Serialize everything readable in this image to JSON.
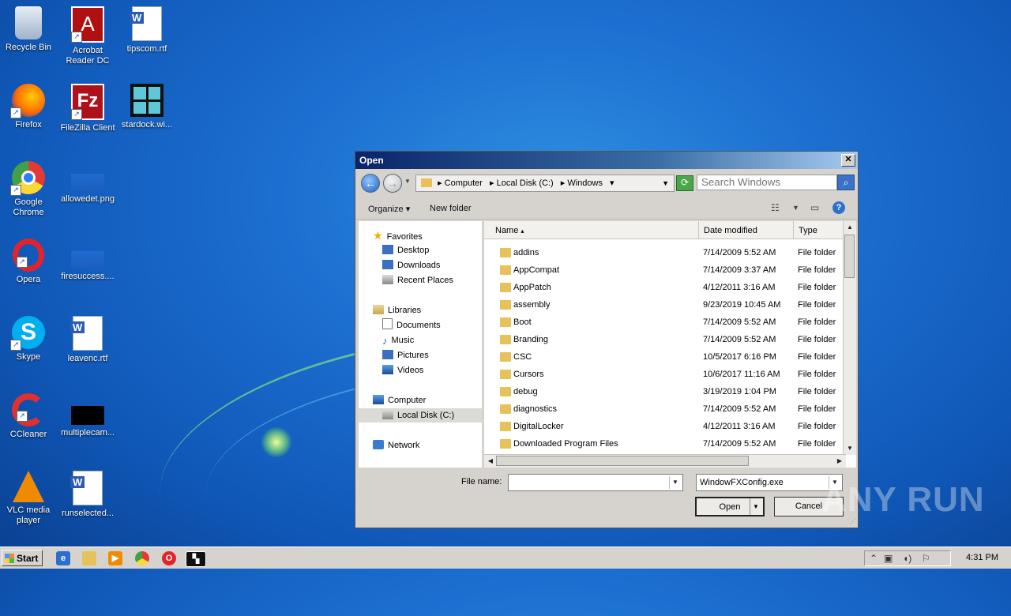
{
  "desktop": {
    "icons": [
      {
        "label": "Recycle Bin"
      },
      {
        "label": "Acrobat Reader DC"
      },
      {
        "label": "tipscom.rtf"
      },
      {
        "label": "Firefox"
      },
      {
        "label": "FileZilla Client"
      },
      {
        "label": "stardock.wi..."
      },
      {
        "label": "Google Chrome"
      },
      {
        "label": "allowedet.png"
      },
      {
        "label": "Opera"
      },
      {
        "label": "firesuccess...."
      },
      {
        "label": "Skype"
      },
      {
        "label": "leavenc.rtf"
      },
      {
        "label": "CCleaner"
      },
      {
        "label": "multiplecam..."
      },
      {
        "label": "VLC media player"
      },
      {
        "label": "runselected..."
      }
    ],
    "watermark": "ANY RUN"
  },
  "dialog": {
    "title": "Open",
    "address": {
      "crumbs": [
        "Computer",
        "Local Disk (C:)",
        "Windows"
      ]
    },
    "search": {
      "placeholder": "Search Windows"
    },
    "toolbar": {
      "organize": "Organize",
      "new_folder": "New folder"
    },
    "nav": {
      "favorites": "Favorites",
      "desktop": "Desktop",
      "downloads": "Downloads",
      "recent": "Recent Places",
      "libraries": "Libraries",
      "documents": "Documents",
      "music": "Music",
      "pictures": "Pictures",
      "videos": "Videos",
      "computer": "Computer",
      "local_disk": "Local Disk (C:)",
      "network": "Network"
    },
    "columns": {
      "name": "Name",
      "date": "Date modified",
      "type": "Type"
    },
    "files": [
      {
        "name": "addins",
        "date": "7/14/2009 5:52 AM",
        "type": "File folder"
      },
      {
        "name": "AppCompat",
        "date": "7/14/2009 3:37 AM",
        "type": "File folder"
      },
      {
        "name": "AppPatch",
        "date": "4/12/2011 3:16 AM",
        "type": "File folder"
      },
      {
        "name": "assembly",
        "date": "9/23/2019 10:45 AM",
        "type": "File folder"
      },
      {
        "name": "Boot",
        "date": "7/14/2009 5:52 AM",
        "type": "File folder"
      },
      {
        "name": "Branding",
        "date": "7/14/2009 5:52 AM",
        "type": "File folder"
      },
      {
        "name": "CSC",
        "date": "10/5/2017 6:16 PM",
        "type": "File folder"
      },
      {
        "name": "Cursors",
        "date": "10/6/2017 11:16 AM",
        "type": "File folder"
      },
      {
        "name": "debug",
        "date": "3/19/2019 1:04 PM",
        "type": "File folder"
      },
      {
        "name": "diagnostics",
        "date": "7/14/2009 5:52 AM",
        "type": "File folder"
      },
      {
        "name": "DigitalLocker",
        "date": "4/12/2011 3:16 AM",
        "type": "File folder"
      },
      {
        "name": "Downloaded Program Files",
        "date": "7/14/2009 5:52 AM",
        "type": "File folder"
      }
    ],
    "file_name_label": "File name:",
    "file_name_value": "",
    "filter_value": "WindowFXConfig.exe",
    "open_label": "Open",
    "cancel_label": "Cancel"
  },
  "taskbar": {
    "start_label": "Start",
    "clock": "4:31 PM"
  }
}
